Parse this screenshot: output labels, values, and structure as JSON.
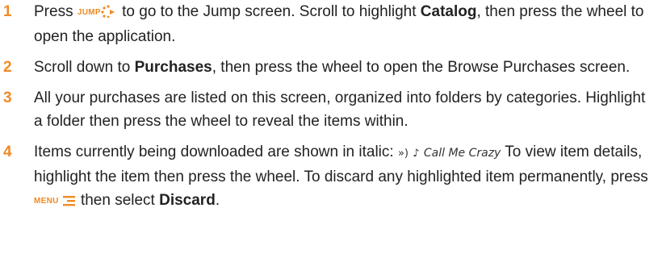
{
  "steps": [
    {
      "num": "1",
      "a": "Press ",
      "jump_key": "JUMP",
      "b": " to go to the Jump screen. Scroll to highlight ",
      "bold": "Catalog",
      "c": ", then press the wheel to open the application."
    },
    {
      "num": "2",
      "a": "Scroll down to ",
      "bold": "Purchases",
      "c": ", then press the wheel to open the Browse Purchases screen."
    },
    {
      "num": "3",
      "text": "All your purchases are listed on this screen, organized into folders by categories. Highlight a folder then press the wheel to reveal the items within."
    },
    {
      "num": "4",
      "a": "Items currently being downloaded are shown in italic: ",
      "sound_glyph": "»)",
      "note_glyph": "♪",
      "item_name": "Call Me Crazy",
      "b": "To view item details, highlight the item then press the wheel. To discard any highlighted item permanently, press ",
      "menu_key": "MENU",
      "c": " then select ",
      "bold": "Discard",
      "d": "."
    }
  ],
  "colors": {
    "accent": "#f08a24",
    "text": "#222222"
  },
  "icons": {
    "jump": "jump-dots-icon",
    "menu": "menu-lines-icon",
    "sound": "sound-icon",
    "note": "music-note-icon"
  }
}
